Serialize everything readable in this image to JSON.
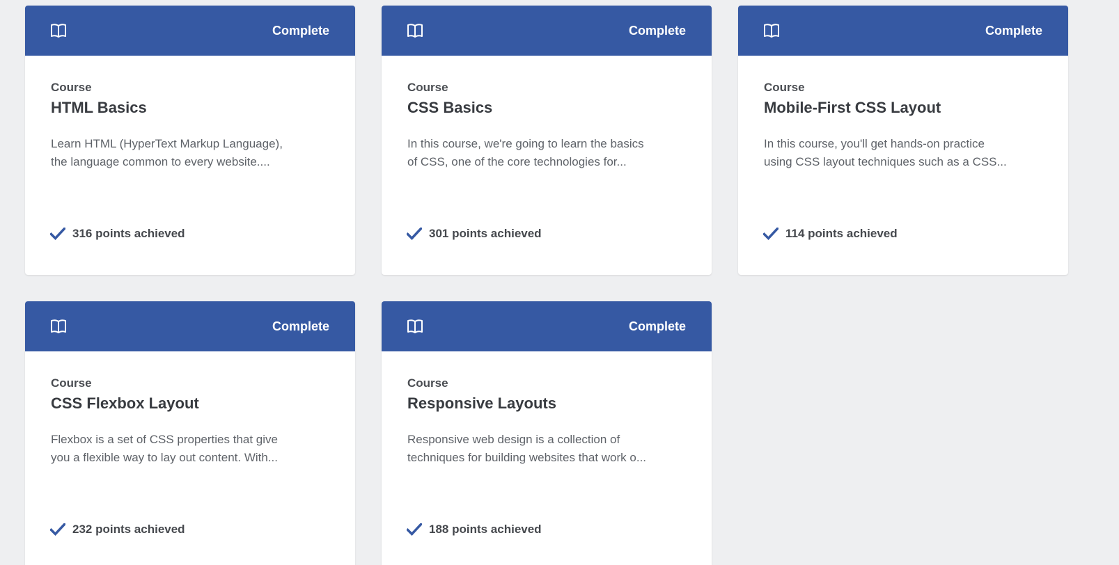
{
  "colors": {
    "accent": "#3659a3",
    "background": "#eeeff1",
    "card": "#ffffff"
  },
  "cards": [
    {
      "icon": "book-icon",
      "status": "Complete",
      "kind": "Course",
      "title": "HTML Basics",
      "description_line1": "Learn HTML (HyperText Markup Language),",
      "description_line2": "the language common to every website....",
      "points": "316 points achieved"
    },
    {
      "icon": "book-icon",
      "status": "Complete",
      "kind": "Course",
      "title": "CSS Basics",
      "description_line1": "In this course, we're going to learn the basics",
      "description_line2": "of CSS, one of the core technologies for...",
      "points": "301 points achieved"
    },
    {
      "icon": "book-icon",
      "status": "Complete",
      "kind": "Course",
      "title": "Mobile-First CSS Layout",
      "description_line1": "In this course, you'll get hands-on practice",
      "description_line2": "using CSS layout techniques such as a CSS...",
      "points": "114 points achieved"
    },
    {
      "icon": "book-icon",
      "status": "Complete",
      "kind": "Course",
      "title": "CSS Flexbox Layout",
      "description_line1": "Flexbox is a set of CSS properties that give",
      "description_line2": "you a flexible way to lay out content. With...",
      "points": "232 points achieved"
    },
    {
      "icon": "book-icon",
      "status": "Complete",
      "kind": "Course",
      "title": "Responsive Layouts",
      "description_line1": "Responsive web design is a collection of",
      "description_line2": "techniques for building websites that work o...",
      "points": "188 points achieved"
    }
  ]
}
